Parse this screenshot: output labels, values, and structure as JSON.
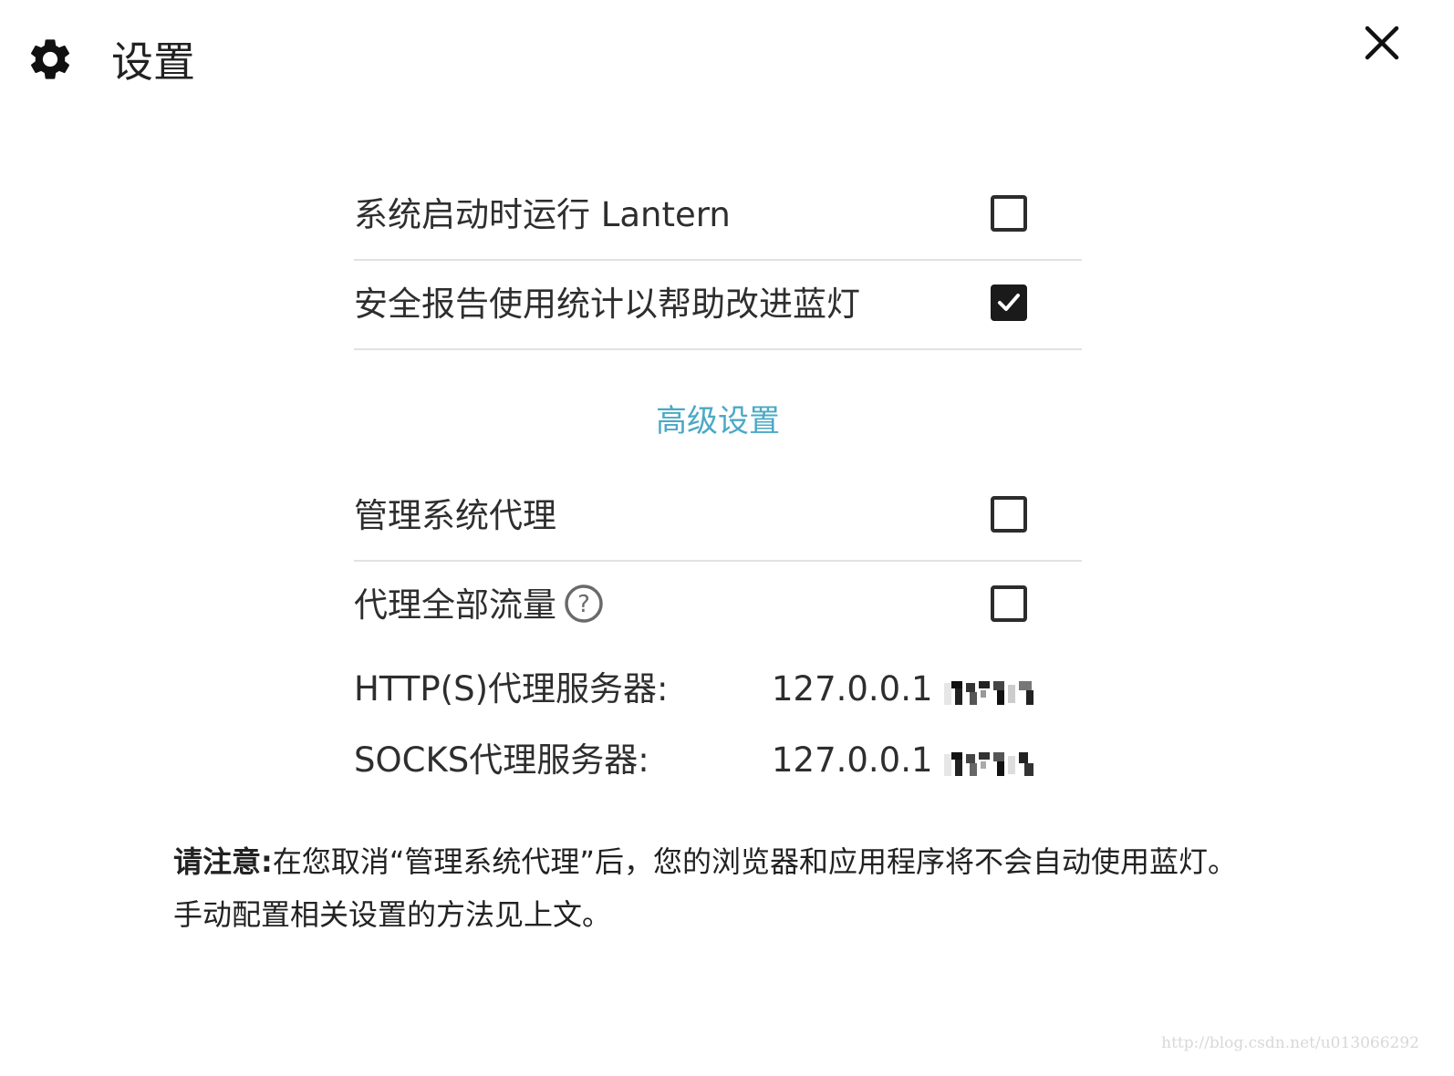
{
  "header": {
    "title": "设置",
    "gear_icon": "gear-icon",
    "close_icon": "close-icon"
  },
  "settings": {
    "rows": [
      {
        "label": "系统启动时运行 Lantern",
        "checked": false
      },
      {
        "label": "安全报告使用统计以帮助改进蓝灯",
        "checked": true
      }
    ]
  },
  "advanced": {
    "heading": "高级设置",
    "heading_color": "#4aa9c5",
    "rows": [
      {
        "label": "管理系统代理",
        "checked": false
      },
      {
        "label": "代理全部流量",
        "checked": false,
        "help_icon": "help-circle-icon"
      }
    ],
    "servers": [
      {
        "label": "HTTP(S)代理服务器:",
        "value": "127.0.0.1"
      },
      {
        "label": "SOCKS代理服务器:",
        "value": "127.0.0.1"
      }
    ]
  },
  "note": {
    "prefix": "请注意:",
    "text": "在您取消“管理系统代理”后，您的浏览器和应用程序将不会自动使用蓝灯。手动配置相关设置的方法见上文。"
  },
  "watermark": "http://blog.csdn.net/u013066292"
}
